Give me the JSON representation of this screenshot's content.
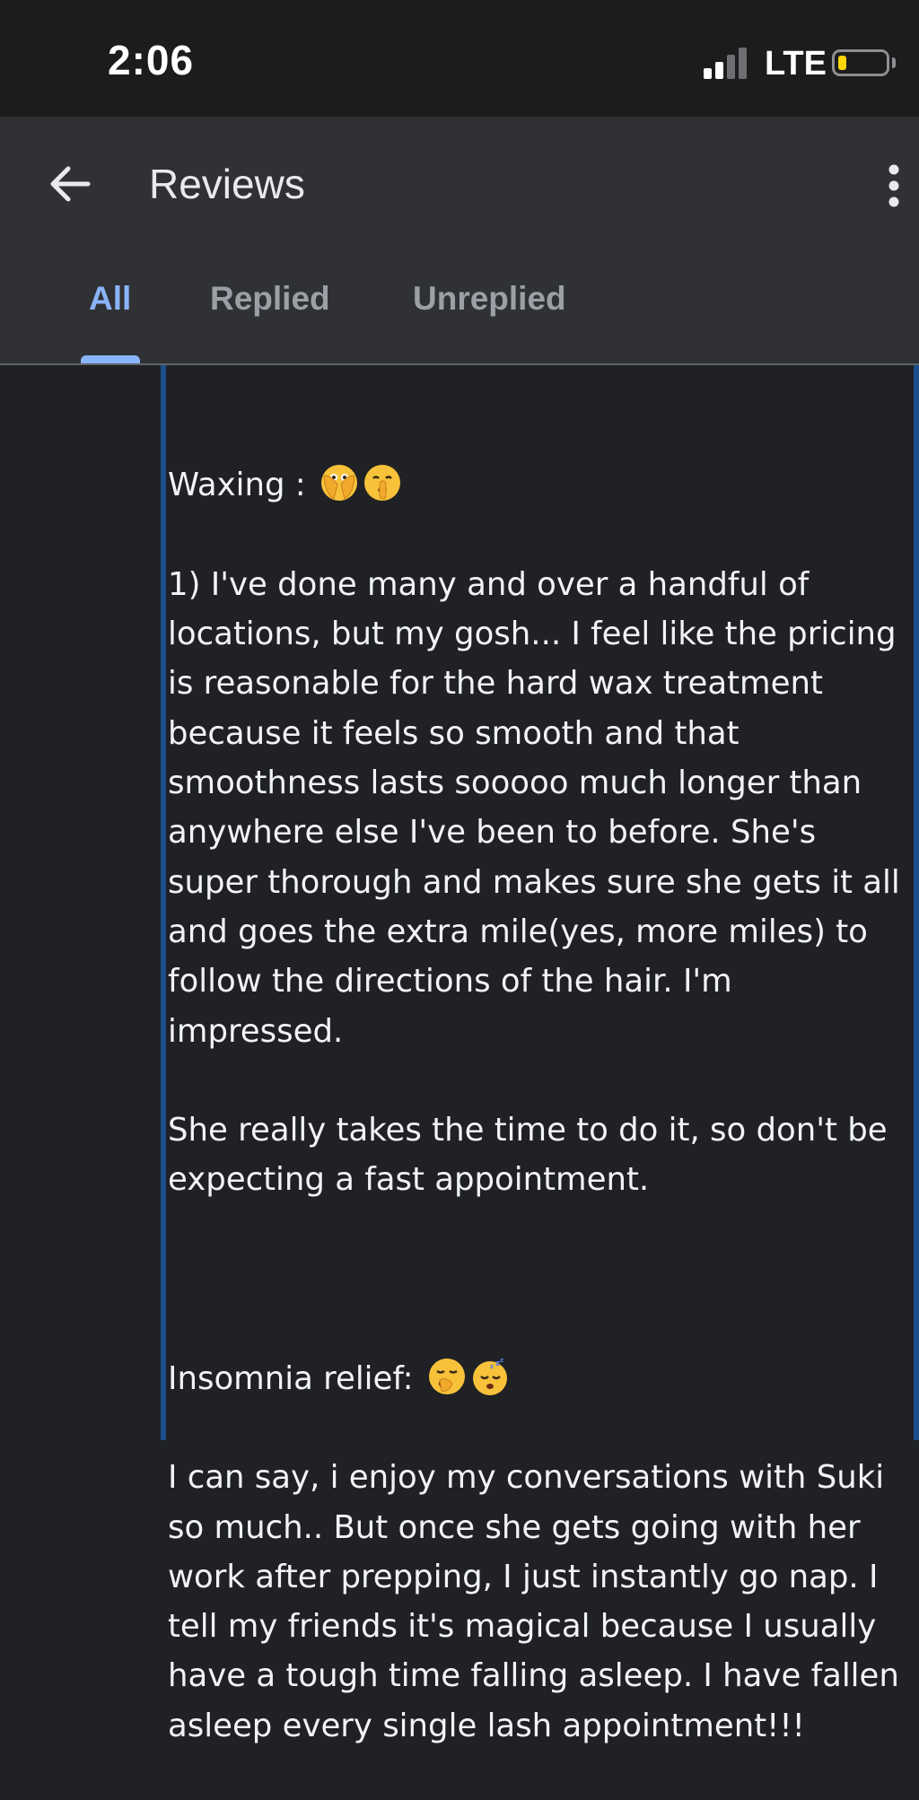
{
  "status_bar": {
    "time": "2:06",
    "network": "LTE",
    "battery_level": 0.15,
    "battery_color": "#ffd60a",
    "signal_bars_active": 2,
    "signal_bars_total": 4
  },
  "app_bar": {
    "title": "Reviews",
    "back_icon": "arrow-back-icon",
    "more_icon": "more-vert-icon"
  },
  "tabs": [
    {
      "label": "All",
      "active": true
    },
    {
      "label": "Replied",
      "active": false
    },
    {
      "label": "Unreplied",
      "active": false
    }
  ],
  "colors": {
    "accent": "#8ab4f8",
    "background": "#202124",
    "app_bar": "#303134",
    "review_border": "#1a4f8c"
  },
  "review": {
    "section1": {
      "heading": "Waxing :",
      "emojis": [
        "face-with-hand-over-mouth-eyes-emoji",
        "shushing-face-emoji"
      ],
      "paragraph1": "1) I've done many and over a handful of locations, but my gosh... I feel like the pricing is reasonable for the hard wax treatment because it feels so smooth and that smoothness lasts sooooo much longer than anywhere else I've been to before. She's super thorough and makes sure she gets it all and goes the extra mile(yes, more miles) to follow the directions of the hair. I'm impressed.",
      "paragraph2": "She really takes the time to do it, so don't be expecting a fast appointment."
    },
    "section2": {
      "heading": "Insomnia relief:",
      "emojis": [
        "yawning-face-emoji",
        "sleeping-face-emoji"
      ],
      "paragraph1": "I can say, i enjoy my conversations with Suki so much.. But once she gets going with her work after prepping, I just instantly go nap. I tell my friends it's magical because I usually have a tough time falling asleep. I have fallen asleep every single lash appointment!!!"
    }
  }
}
